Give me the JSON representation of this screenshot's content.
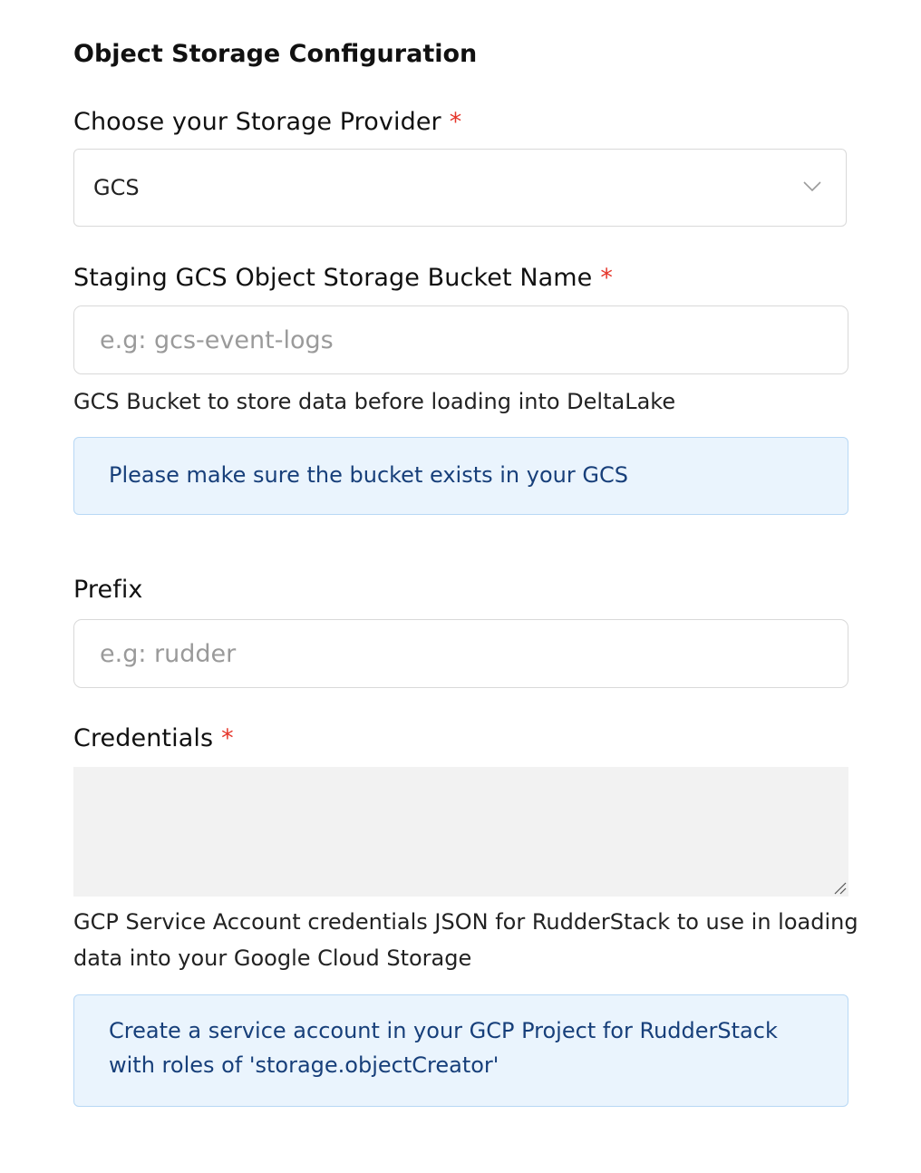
{
  "section": {
    "title": "Object Storage Configuration"
  },
  "provider": {
    "label": "Choose your Storage Provider",
    "required_mark": "*",
    "selected": "GCS"
  },
  "bucket": {
    "label": "Staging GCS Object Storage Bucket Name",
    "required_mark": "*",
    "placeholder": "e.g: gcs-event-logs",
    "value": "",
    "help": "GCS Bucket to store data before loading into DeltaLake",
    "info": "Please make sure the bucket exists in your GCS"
  },
  "prefix": {
    "label": "Prefix",
    "placeholder": "e.g: rudder",
    "value": ""
  },
  "credentials": {
    "label": "Credentials",
    "required_mark": "*",
    "value": "",
    "help": "GCP Service Account credentials JSON for RudderStack to use in loading data into your Google Cloud Storage",
    "info": "Create a service account in your GCP Project for RudderStack with roles of 'storage.objectCreator'"
  },
  "icons": {
    "dropdown": "chevron-down-icon",
    "resize": "resize-handle-icon"
  },
  "colors": {
    "required": "#e5362b",
    "info_bg": "#eaf4fd",
    "info_border": "#b8d8f5",
    "info_text": "#173f7a",
    "textarea_bg": "#f2f2f2"
  }
}
